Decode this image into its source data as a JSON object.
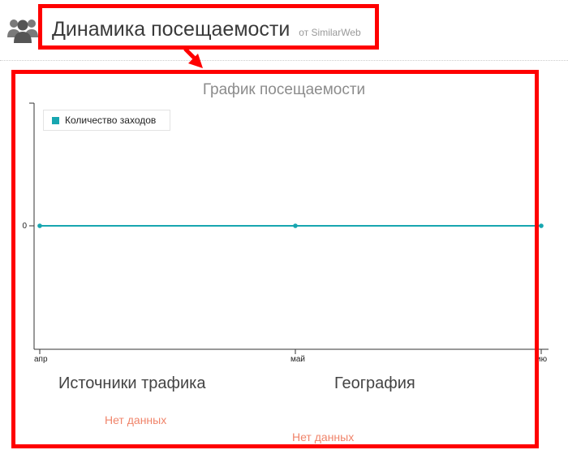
{
  "header": {
    "icon": "users-icon",
    "title": "Динамика посещаемости",
    "subtitle": "от SimilarWeb"
  },
  "annotation_color": "#ff0000",
  "chart_data": {
    "type": "line",
    "title": "График посещаемости",
    "categories": [
      "апр",
      "май",
      "ию"
    ],
    "series": [
      {
        "name": "Количество заходов",
        "values": [
          0,
          0,
          0
        ],
        "color": "#17a6b0"
      }
    ],
    "yticks": [
      "0"
    ],
    "legend": "top-left",
    "grid": false
  },
  "sections": {
    "traffic_sources": {
      "title": "Источники трафика",
      "status": "Нет данных"
    },
    "geography": {
      "title": "География",
      "status": "Нет данных"
    }
  }
}
